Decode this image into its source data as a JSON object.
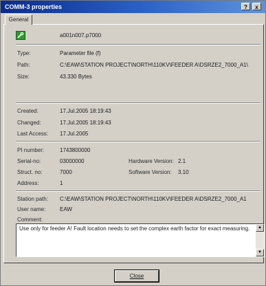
{
  "window": {
    "title": "COMM-3 properties",
    "help_label": "?",
    "close_label": "x"
  },
  "tabs": [
    {
      "label": "General"
    }
  ],
  "file": {
    "name": "a001n007.p7000",
    "icon": "tool-file-icon"
  },
  "info": {
    "type_label": "Type:",
    "type_value": "Parameter file (f)",
    "path_label": "Path:",
    "path_value": "C:\\EAW\\STATION PROJECT\\NORTH\\110KV\\FEEDER A\\DSRZE2_7000_A1\\",
    "size_label": "Size:",
    "size_value": "43.330 Bytes"
  },
  "dates": {
    "created_label": "Created:",
    "created_value": "17.Jul.2005   18:19:43",
    "changed_label": "Changed:",
    "changed_value": "17.Jul.2005   18:19:43",
    "accessed_label": "Last Access:",
    "accessed_value": "17.Jul.2005"
  },
  "device": {
    "pi_label": "PI number:",
    "pi_value": "1743800000",
    "serial_label": "Serial-no:",
    "serial_value": "03000000",
    "struct_label": "Struct. no:",
    "struct_value": "7000",
    "address_label": "Address:",
    "address_value": "1",
    "hw_label": "Hardware Version:",
    "hw_value": "2.1",
    "sw_label": "Software Version:",
    "sw_value": "3.10"
  },
  "station": {
    "path_label": "Station path:",
    "path_value": "C:\\EAW\\STATION PROJECT\\NORTH\\110KV\\FEEDER A\\DSRZE2_7000_A1",
    "user_label": "User name:",
    "user_value": "EAW",
    "comment_label": "Comment:",
    "comment_value": "Use only for feeder A! Fault location needs to set the complex earth factor for exact measuring."
  },
  "buttons": {
    "close": "Close"
  }
}
